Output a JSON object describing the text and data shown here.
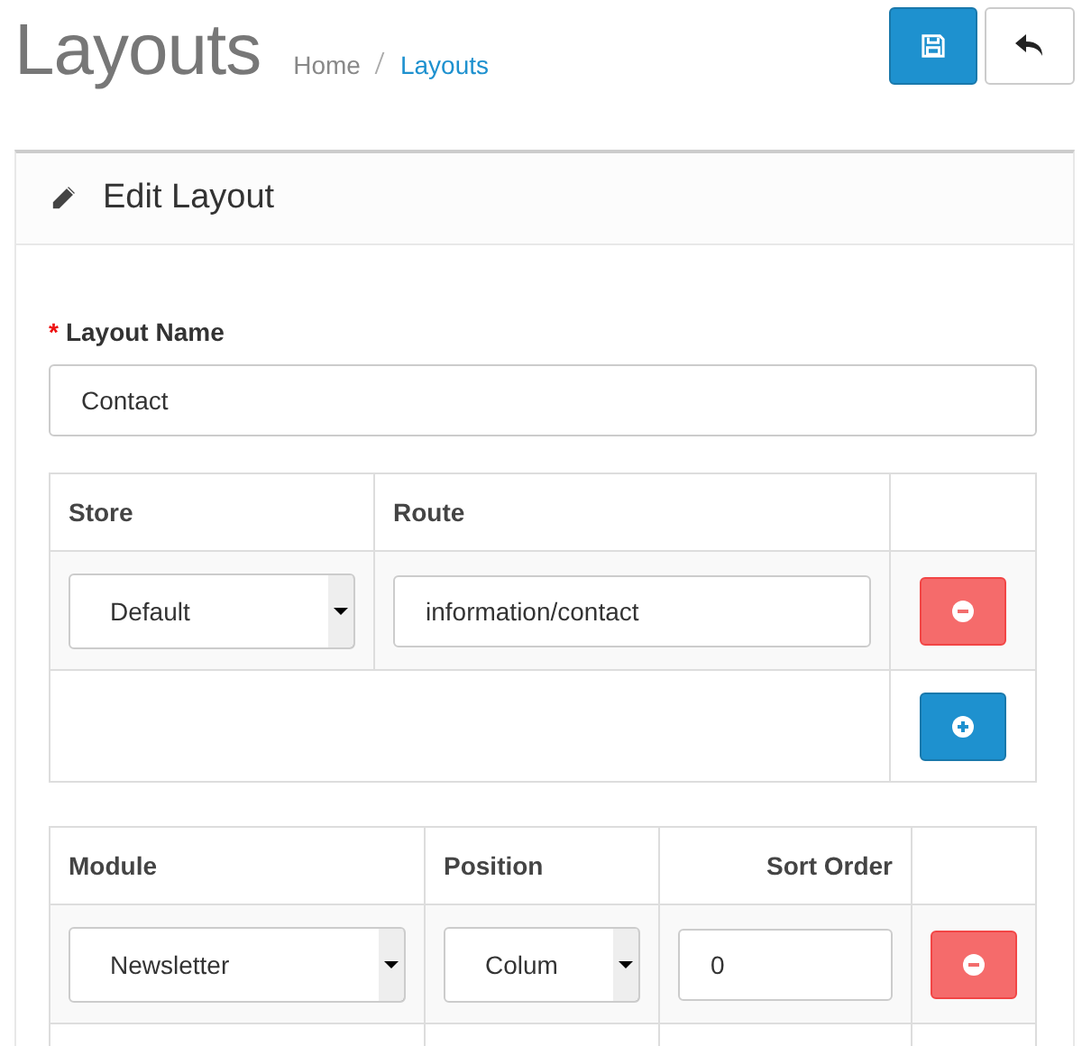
{
  "page": {
    "title": "Layouts",
    "breadcrumb": [
      {
        "label": "Home",
        "selected": false
      },
      {
        "label": "Layouts",
        "selected": true
      }
    ]
  },
  "panel": {
    "title": "Edit Layout",
    "required_mark": "*",
    "name_label": "Layout Name",
    "name_value": "Contact"
  },
  "route_table": {
    "columns": [
      "Store",
      "Route"
    ],
    "rows": [
      {
        "store": "Default",
        "route": "information/contact"
      }
    ]
  },
  "module_table": {
    "columns": [
      "Module",
      "Position",
      "Sort Order"
    ],
    "rows": [
      {
        "module": "Newsletter",
        "position": "Colum",
        "sort_order": "0"
      }
    ]
  }
}
